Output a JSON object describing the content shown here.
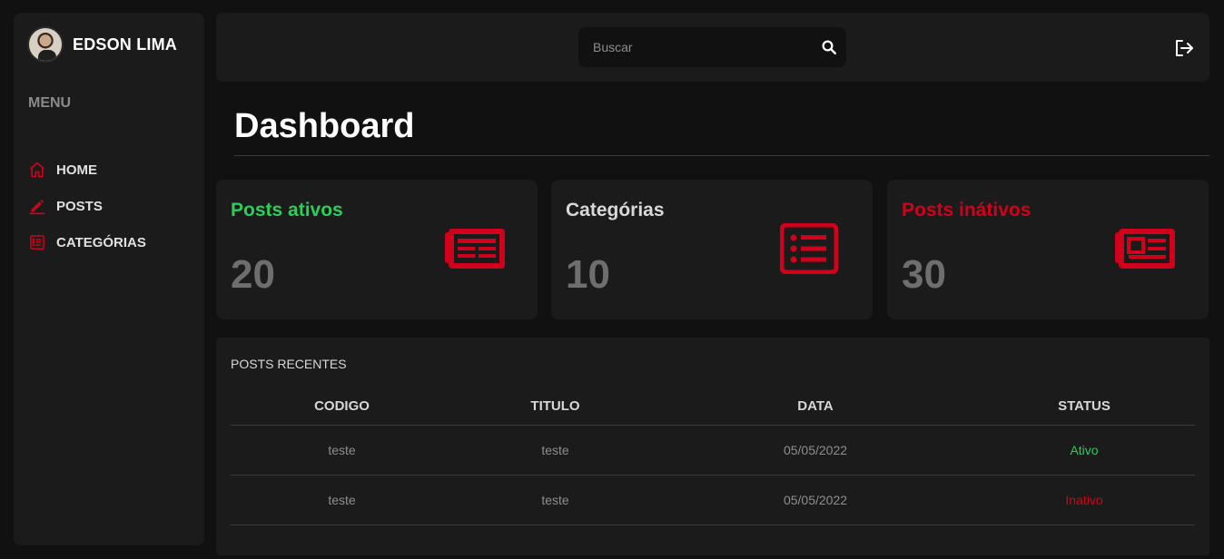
{
  "sidebar": {
    "user_name": "EDSON LIMA",
    "menu_title": "MENU",
    "items": [
      {
        "label": "HOME",
        "icon": "home-icon"
      },
      {
        "label": "POSTS",
        "icon": "pencil-icon"
      },
      {
        "label": "CATEGÓRIAS",
        "icon": "list-box-icon"
      }
    ]
  },
  "topbar": {
    "search_placeholder": "Buscar",
    "search_value": "",
    "logout_icon": "logout-icon"
  },
  "page": {
    "title": "Dashboard"
  },
  "cards": [
    {
      "title": "Posts ativos",
      "value": "20",
      "title_color": "#2ecc5a",
      "icon": "newspaper-icon"
    },
    {
      "title": "Categórias",
      "value": "10",
      "title_color": "#d8d8d8",
      "icon": "list-icon"
    },
    {
      "title": "Posts inátivos",
      "value": "30",
      "title_color": "#d0021b",
      "icon": "newspaper-alt-icon"
    }
  ],
  "recent": {
    "title": "POSTS RECENTES",
    "columns": [
      "CODIGO",
      "TITULO",
      "DATA",
      "STATUS"
    ],
    "rows": [
      {
        "codigo": "teste",
        "titulo": "teste",
        "data": "05/05/2022",
        "status": "Ativo",
        "status_color": "#2ecc5a"
      },
      {
        "codigo": "teste",
        "titulo": "teste",
        "data": "05/05/2022",
        "status": "Inativo",
        "status_color": "#d0021b"
      }
    ]
  },
  "colors": {
    "accent": "#d0021b",
    "active": "#2ecc5a",
    "background": "#111111",
    "panel": "#1b1b1b"
  }
}
